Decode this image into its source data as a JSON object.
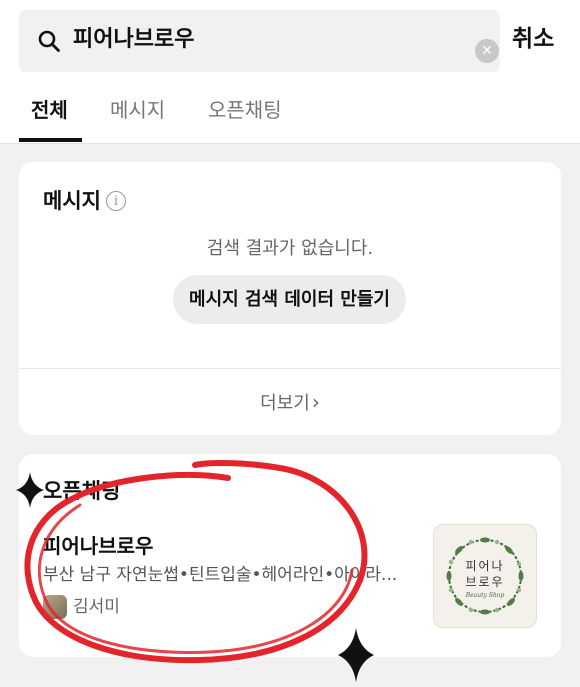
{
  "search": {
    "query": "피어나브로우",
    "cancel_label": "취소"
  },
  "tabs": [
    {
      "label": "전체",
      "active": true
    },
    {
      "label": "메시지",
      "active": false
    },
    {
      "label": "오픈채팅",
      "active": false
    }
  ],
  "message_section": {
    "title": "메시지",
    "info_icon": "ⓘ",
    "empty_text": "검색 결과가 없습니다.",
    "make_button": "메시지 검색 데이터 만들기",
    "more_label": "더보기",
    "more_chevron": "›"
  },
  "open_chat_section": {
    "title": "오픈채팅",
    "room": {
      "name": "피어나브로우",
      "description": "부산 남구 자연눈썹•틴트입술•헤어라인•아이라...",
      "host": "김서미",
      "logo_line1": "피어나",
      "logo_line2": "브로우",
      "logo_sub": "Beauty Shop"
    }
  },
  "colors": {
    "highlight_ink": "#e3242b",
    "sparkle": "#111111",
    "tab_active": "#111111"
  },
  "icons": {
    "search": "search-icon",
    "clear": "clear-icon",
    "info": "info-icon",
    "chevron": "chevron-right-icon"
  }
}
